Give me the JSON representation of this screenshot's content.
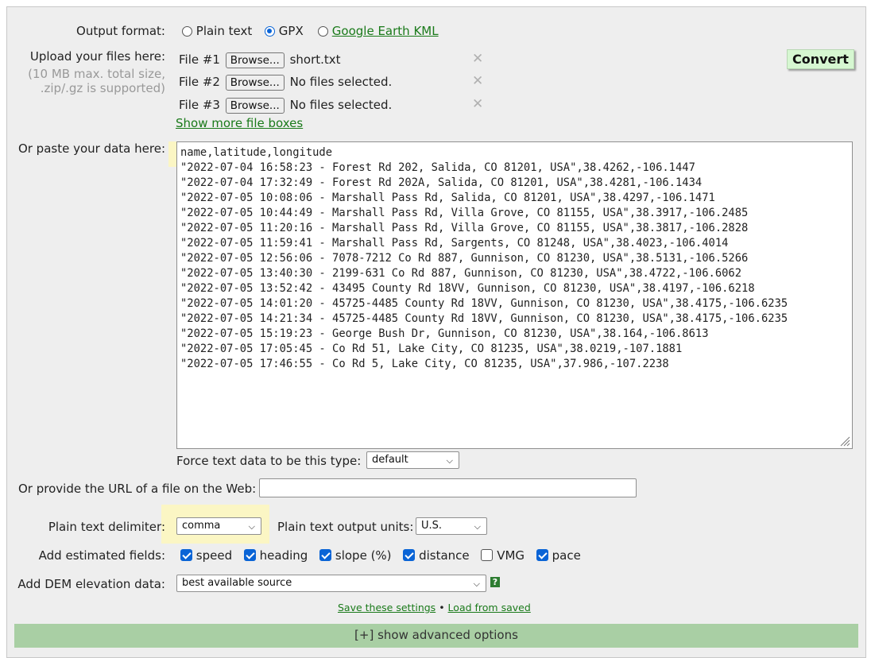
{
  "output_format": {
    "label": "Output format:",
    "options": [
      {
        "label": "Plain text",
        "selected": false
      },
      {
        "label": "GPX",
        "selected": true
      },
      {
        "label": "Google Earth KML",
        "selected": false
      }
    ]
  },
  "upload": {
    "label": "Upload your files here:",
    "hint_line1": "(10 MB max. total size,",
    "hint_line2": ".zip/.gz is supported)",
    "browse_label": "Browse...",
    "files": [
      {
        "label": "File #1",
        "name": "short.txt"
      },
      {
        "label": "File #2",
        "name": "No files selected."
      },
      {
        "label": "File #3",
        "name": "No files selected."
      }
    ],
    "remove_glyph": "✕",
    "show_more": "Show more file boxes",
    "convert_label": "Convert"
  },
  "paste": {
    "label": "Or paste your data here:",
    "lines": [
      "name,latitude,longitude",
      "\"2022-07-04 16:58:23 - Forest Rd 202, Salida, CO 81201, USA\",38.4262,-106.1447",
      "\"2022-07-04 17:32:49 - Forest Rd 202A, Salida, CO 81201, USA\",38.4281,-106.1434",
      "\"2022-07-05 10:08:06 - Marshall Pass Rd, Salida, CO 81201, USA\",38.4297,-106.1471",
      "\"2022-07-05 10:44:49 - Marshall Pass Rd, Villa Grove, CO 81155, USA\",38.3917,-106.2485",
      "\"2022-07-05 11:20:16 - Marshall Pass Rd, Villa Grove, CO 81155, USA\",38.3817,-106.2828",
      "\"2022-07-05 11:59:41 - Marshall Pass Rd, Sargents, CO 81248, USA\",38.4023,-106.4014",
      "\"2022-07-05 12:56:06 - 7078-7212 Co Rd 887, Gunnison, CO 81230, USA\",38.5131,-106.5266",
      "\"2022-07-05 13:40:30 - 2199-631 Co Rd 887, Gunnison, CO 81230, USA\",38.4722,-106.6062",
      "\"2022-07-05 13:52:42 - 43495 County Rd 18VV, Gunnison, CO 81230, USA\",38.4197,-106.6218",
      "\"2022-07-05 14:01:20 - 45725-4485 County Rd 18VV, Gunnison, CO 81230, USA\",38.4175,-106.6235",
      "\"2022-07-05 14:21:34 - 45725-4485 County Rd 18VV, Gunnison, CO 81230, USA\",38.4175,-106.6235",
      "\"2022-07-05 15:19:23 - George Bush Dr, Gunnison, CO 81230, USA\",38.164,-106.8613",
      "\"2022-07-05 17:05:45 - Co Rd 51, Lake City, CO 81235, USA\",38.0219,-107.1881",
      "\"2022-07-05 17:46:55 - Co Rd 5, Lake City, CO 81235, USA\",37.986,-107.2238"
    ]
  },
  "force_type": {
    "label": "Force text data to be this type:",
    "value": "default"
  },
  "url": {
    "label": "Or provide the URL of a file on the Web:",
    "value": ""
  },
  "delimiter": {
    "label": "Plain text delimiter:",
    "value": "comma"
  },
  "units": {
    "label": "Plain text output units:",
    "value": "U.S."
  },
  "estimated": {
    "label": "Add estimated fields:",
    "fields": [
      {
        "label": "speed",
        "checked": true
      },
      {
        "label": "heading",
        "checked": true
      },
      {
        "label": "slope (%)",
        "checked": true
      },
      {
        "label": "distance",
        "checked": true
      },
      {
        "label": "VMG",
        "checked": false
      },
      {
        "label": "pace",
        "checked": true
      }
    ]
  },
  "dem": {
    "label": "Add DEM elevation data:",
    "value": "best available source",
    "help": "?"
  },
  "settings": {
    "save": "Save these settings",
    "separator": "•",
    "load": "Load from saved"
  },
  "advanced": {
    "label": "[+] show advanced options"
  },
  "colors": {
    "accent": "#0a64d6",
    "link": "#1a7a1a",
    "convert_bg": "#d6f7d1",
    "highlight": "#fbf6c4",
    "advanced_bar": "#a9cfa4"
  }
}
